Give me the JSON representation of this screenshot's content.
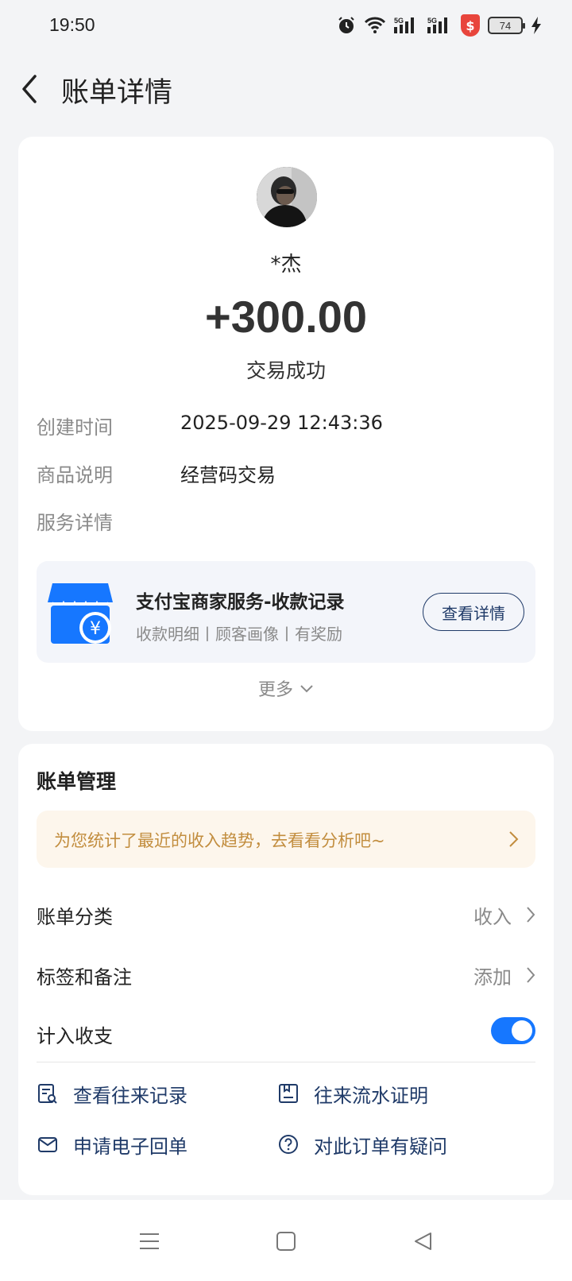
{
  "status_bar": {
    "time": "19:50",
    "battery": "74",
    "icons": [
      "alarm-icon",
      "wifi-icon",
      "signal-5g-icon",
      "signal-5g-icon",
      "security-shield-icon",
      "battery-icon",
      "charging-icon"
    ]
  },
  "header": {
    "title": "账单详情"
  },
  "transaction": {
    "name": "*杰",
    "amount": "+300.00",
    "status": "交易成功",
    "created_label": "创建时间",
    "created_value": "2025-09-29 12:43:36",
    "desc_label": "商品说明",
    "desc_value": "经营码交易",
    "service_label": "服务详情"
  },
  "service": {
    "title": "支付宝商家服务-收款记录",
    "subtitle": "收款明细丨顾客画像丨有奖励",
    "button": "查看详情"
  },
  "more_label": "更多",
  "management": {
    "title": "账单管理",
    "tip": "为您统计了最近的收入趋势，去看看分析吧~",
    "rows": [
      {
        "label": "账单分类",
        "value": "收入"
      },
      {
        "label": "标签和备注",
        "value": "添加"
      },
      {
        "label": "计入收支",
        "toggle": true
      }
    ],
    "links": [
      {
        "label": "查看往来记录",
        "icon": "record-search-icon"
      },
      {
        "label": "往来流水证明",
        "icon": "document-icon"
      },
      {
        "label": "申请电子回单",
        "icon": "mail-icon"
      },
      {
        "label": "对此订单有疑问",
        "icon": "question-icon"
      }
    ]
  },
  "colors": {
    "accent": "#1677ff",
    "link": "#1f3a68",
    "tip_bg": "#fdf6ec",
    "tip_text": "#c28d3e"
  }
}
